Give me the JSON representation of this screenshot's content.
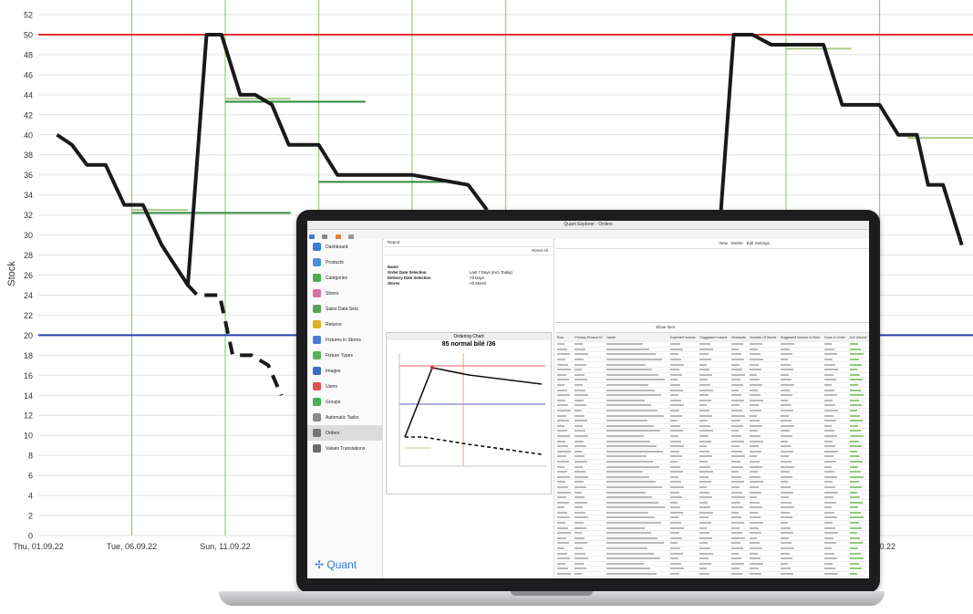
{
  "chart_data": {
    "type": "line",
    "ylabel": "Stock",
    "ylim": [
      0,
      52
    ],
    "yticks": [
      0,
      2,
      4,
      6,
      8,
      10,
      12,
      14,
      16,
      18,
      20,
      22,
      24,
      26,
      28,
      30,
      32,
      34,
      36,
      38,
      40,
      42,
      44,
      46,
      48,
      50,
      52
    ],
    "xlim": [
      0,
      50
    ],
    "x_tick_labels": [
      {
        "x": 0,
        "label": "Thu, 01.09.22"
      },
      {
        "x": 5,
        "label": "Tue, 06.09.22"
      },
      {
        "x": 10,
        "label": "Sun, 11.09.22"
      },
      {
        "x": 45,
        "label": "16.10.22"
      }
    ],
    "vertical_markers_x": [
      5,
      10,
      15,
      20,
      25,
      40,
      45
    ],
    "reference_lines": [
      {
        "name": "max",
        "y": 50,
        "color": "#e03030"
      },
      {
        "name": "min",
        "y": 20,
        "color": "#2a3fb0"
      }
    ],
    "series": [
      {
        "style": "solid",
        "color": "#1a1a1a",
        "points": [
          [
            1,
            40
          ],
          [
            1.8,
            39
          ],
          [
            2.6,
            37
          ],
          [
            3.6,
            37
          ],
          [
            4.6,
            33
          ],
          [
            5.6,
            33
          ],
          [
            6.6,
            29
          ],
          [
            8,
            25
          ],
          [
            9,
            50
          ],
          [
            9.8,
            50
          ],
          [
            10.8,
            44
          ],
          [
            11.6,
            44
          ],
          [
            12.5,
            43
          ],
          [
            13.4,
            39
          ],
          [
            15,
            39
          ],
          [
            16,
            36
          ],
          [
            20,
            36
          ],
          [
            23,
            35
          ],
          [
            24,
            32.5
          ]
        ]
      },
      {
        "style": "solid",
        "color": "#1a1a1a",
        "points": [
          [
            36.5,
            32
          ],
          [
            37.2,
            50
          ],
          [
            38.2,
            50
          ],
          [
            39.2,
            49
          ],
          [
            42,
            49
          ],
          [
            43,
            43
          ],
          [
            45,
            43
          ],
          [
            46,
            40
          ],
          [
            47,
            40
          ],
          [
            47.6,
            35
          ],
          [
            48.4,
            35
          ],
          [
            49.4,
            29
          ]
        ]
      },
      {
        "style": "dashed",
        "color": "#1a1a1a",
        "points": [
          [
            8,
            25
          ],
          [
            8.5,
            24
          ],
          [
            9.7,
            24
          ],
          [
            10.4,
            18
          ],
          [
            11.4,
            18
          ],
          [
            12.3,
            17
          ],
          [
            13,
            14
          ]
        ]
      }
    ],
    "order_lines": [
      {
        "x0": 5,
        "x1": 8,
        "y": 32.5,
        "color": "#a8c98a"
      },
      {
        "x0": 5,
        "x1": 13.5,
        "y": 32.2,
        "color": "#2f8a3c"
      },
      {
        "x0": 10,
        "x1": 13.5,
        "y": 43.6,
        "color": "#a8c98a"
      },
      {
        "x0": 10,
        "x1": 17.5,
        "y": 43.3,
        "color": "#2f8a3c"
      },
      {
        "x0": 15,
        "x1": 22.5,
        "y": 35.3,
        "color": "#2f8a3c"
      },
      {
        "x0": 40,
        "x1": 43.5,
        "y": 48.6,
        "color": "#a8c98a"
      },
      {
        "x0": 46.5,
        "x1": 50,
        "y": 39.7,
        "color": "#a8c98a"
      }
    ]
  },
  "app": {
    "window_title": "Quant Explorer - Orders",
    "brand": "Quant",
    "nav": [
      {
        "label": "Dashboard",
        "color": "#3a7bd5"
      },
      {
        "label": "Products",
        "color": "#4a90d9"
      },
      {
        "label": "Categories",
        "color": "#4caf50"
      },
      {
        "label": "Stores",
        "color": "#e06fa8"
      },
      {
        "label": "Sales Data Sets",
        "color": "#5aa05a"
      },
      {
        "label": "Returns",
        "color": "#e0b020"
      },
      {
        "label": "Fixtures in Stores",
        "color": "#4a7bd5"
      },
      {
        "label": "Fixture Types",
        "color": "#5ab05a"
      },
      {
        "label": "Images",
        "color": "#3a6bc5"
      },
      {
        "label": "Users",
        "color": "#e05050"
      },
      {
        "label": "Groups",
        "color": "#4caf50"
      },
      {
        "label": "Automatic Tasks",
        "color": "#8a8a8a"
      },
      {
        "label": "Orders",
        "color": "#777777"
      },
      {
        "label": "Values Translations",
        "color": "#6a6a6a"
      }
    ],
    "report_label": "Report",
    "reset_label": "Reset All",
    "params": [
      {
        "name": "Name",
        "value": ""
      },
      {
        "name": "Order Date Selection",
        "value": "Last 7 Days (incl. Today)"
      },
      {
        "name": "Delivery Date Selection",
        "value": "All Days"
      },
      {
        "name": "Stores",
        "value": "All Stores"
      }
    ],
    "ordering_chart": {
      "window_title": "Ordering Chart",
      "heading": "85 normal bilé /36"
    },
    "buttons": {
      "new": "New",
      "delete": "Delete",
      "edit": "Edit Settings",
      "show": "Show Item"
    },
    "table_headers": [
      "Row",
      "Primary Product ID",
      "Name",
      "Expected Volume",
      "Suggested Volume",
      "Stockouts",
      "Number Of Stores",
      "Suggested Volume in Store",
      "Done in Order",
      "Ack Volume"
    ]
  }
}
